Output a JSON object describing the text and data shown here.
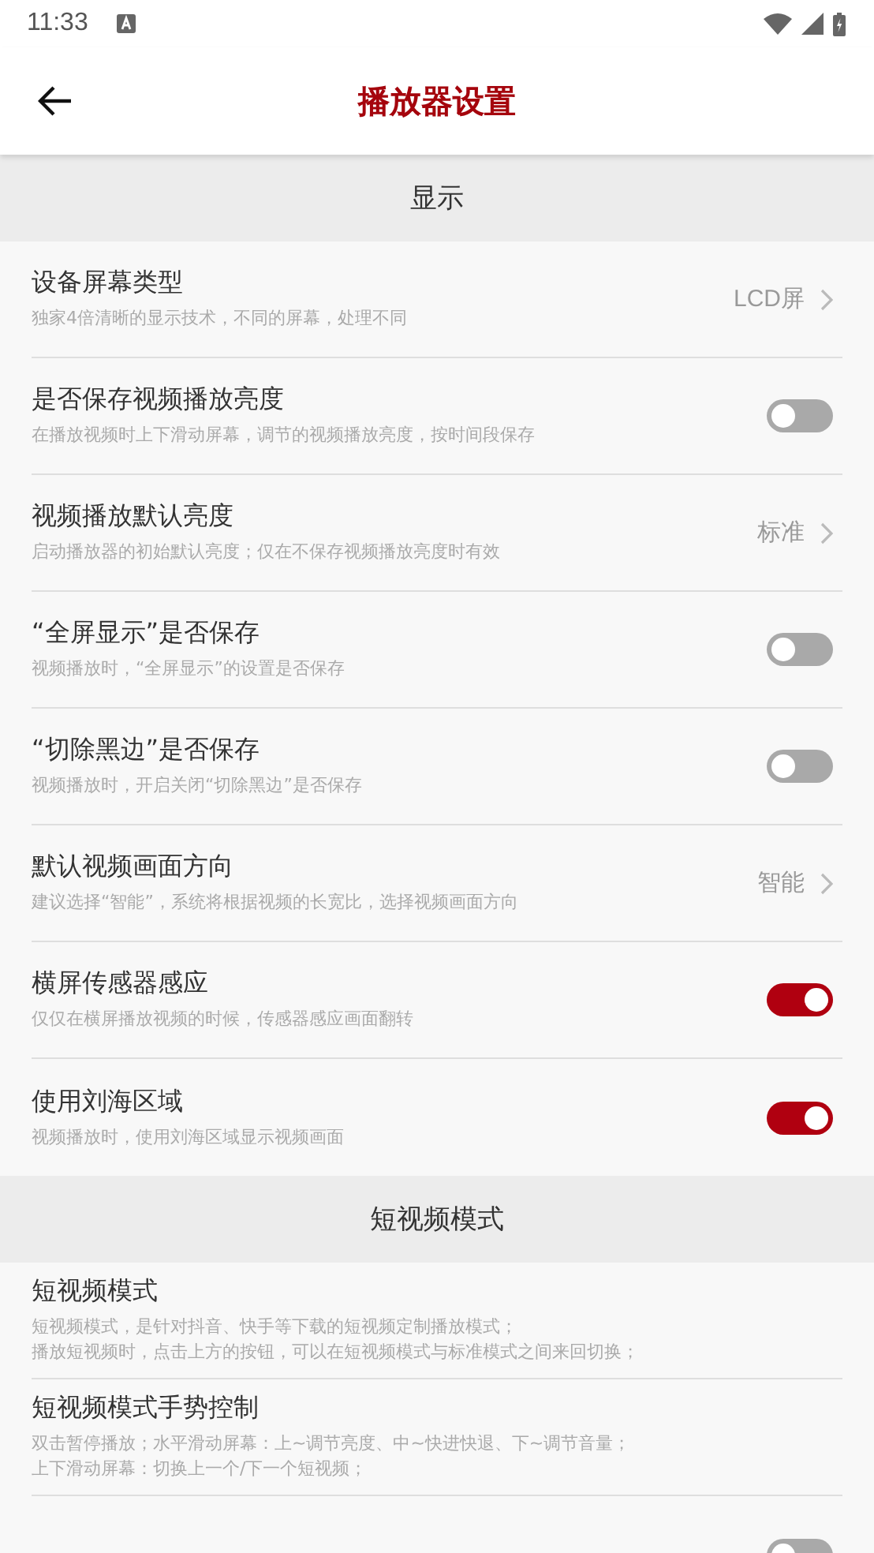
{
  "status_bar": {
    "time": "11:33"
  },
  "app_bar": {
    "title": "播放器设置"
  },
  "sections": [
    {
      "title": "显示",
      "items": [
        {
          "kind": "value",
          "title": "设备屏幕类型",
          "description": [
            "独家4倍清晰的显示技术，不同的屏幕，处理不同"
          ],
          "value": "LCD屏"
        },
        {
          "kind": "toggle",
          "title": "是否保存视频播放亮度",
          "description": [
            "在播放视频时上下滑动屏幕，调节的视频播放亮度，按时间段保存"
          ],
          "on": false
        },
        {
          "kind": "value",
          "title": "视频播放默认亮度",
          "description": [
            "启动播放器的初始默认亮度；仅在不保存视频播放亮度时有效"
          ],
          "value": "标准"
        },
        {
          "kind": "toggle",
          "title": "“全屏显示”是否保存",
          "description": [
            "视频播放时，“全屏显示”的设置是否保存"
          ],
          "on": false
        },
        {
          "kind": "toggle",
          "title": "“切除黑边”是否保存",
          "description": [
            "视频播放时，开启关闭“切除黑边”是否保存"
          ],
          "on": false
        },
        {
          "kind": "value",
          "title": "默认视频画面方向",
          "description": [
            "建议选择“智能”，系统将根据视频的长宽比，选择视频画面方向"
          ],
          "value": "智能"
        },
        {
          "kind": "toggle",
          "title": "横屏传感器感应",
          "description": [
            "仅仅在横屏播放视频的时候，传感器感应画面翻转"
          ],
          "on": true
        },
        {
          "kind": "toggle",
          "title": "使用刘海区域",
          "description": [
            "视频播放时，使用刘海区域显示视频画面"
          ],
          "on": true
        }
      ]
    },
    {
      "title": "短视频模式",
      "items": [
        {
          "kind": "info",
          "title": "短视频模式",
          "description": [
            "短视频模式，是针对抖音、快手等下载的短视频定制播放模式；",
            "播放短视频时，点击上方的按钮，可以在短视频模式与标准模式之间来回切换；"
          ]
        },
        {
          "kind": "info",
          "title": "短视频模式手势控制",
          "description": [
            "双击暂停播放；水平滑动屏幕：上~调节亮度、中~快进快退、下~调节音量；",
            "上下滑动屏幕：切换上一个/下一个短视频；"
          ]
        },
        {
          "kind": "toggle",
          "on": false
        }
      ]
    }
  ]
}
